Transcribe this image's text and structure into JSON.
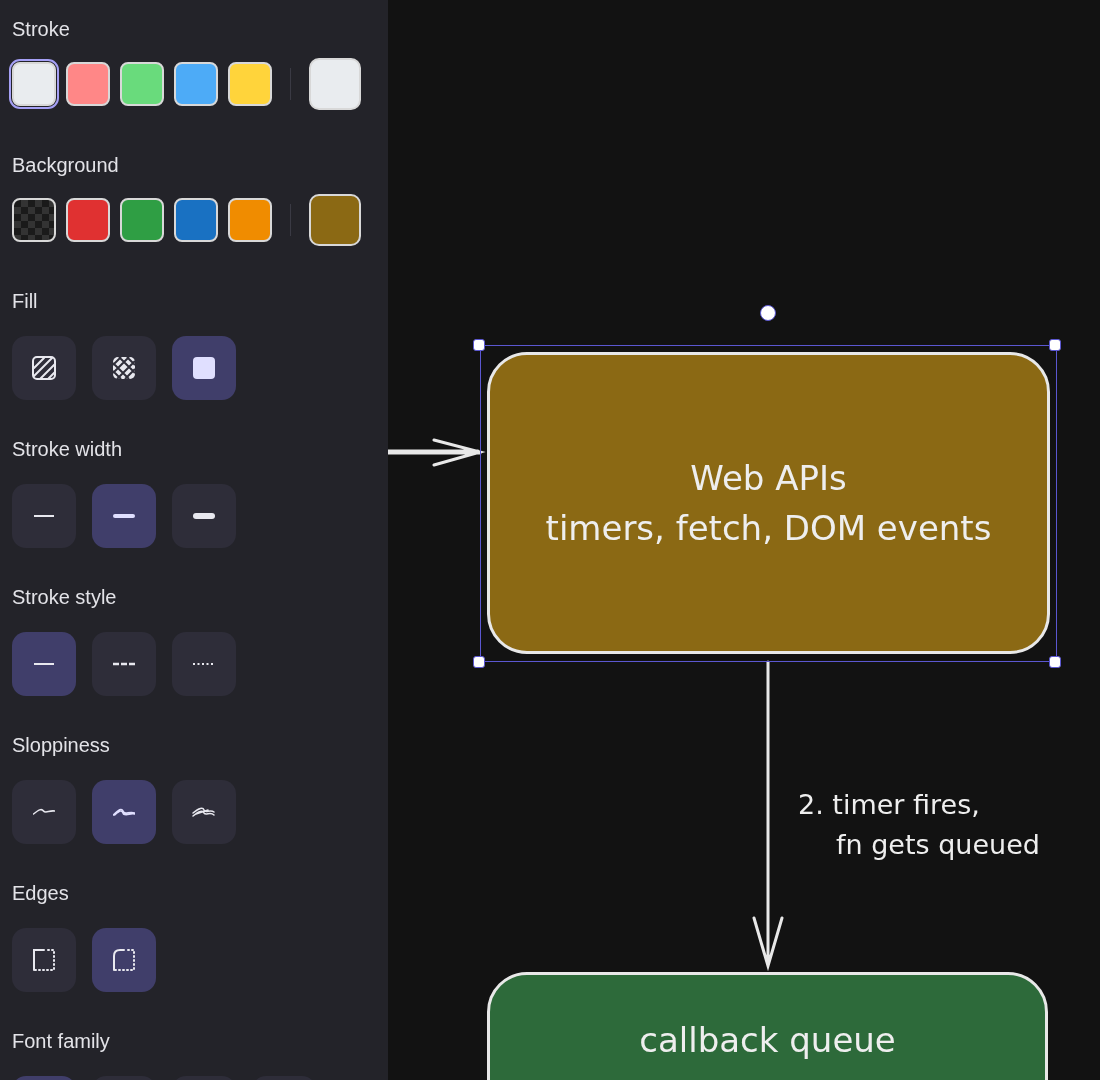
{
  "sidebar": {
    "sections": [
      {
        "kind": "swatches",
        "label": "Stroke",
        "swatches": [
          {
            "kind": "color",
            "color": "#e9ecef",
            "selected": true
          },
          {
            "kind": "color",
            "color": "#ff8787",
            "selected": false
          },
          {
            "kind": "color",
            "color": "#69db7c",
            "selected": false
          },
          {
            "kind": "color",
            "color": "#4dabf7",
            "selected": false
          },
          {
            "kind": "color",
            "color": "#ffd43b",
            "selected": false
          }
        ],
        "current": {
          "color": "#e9ecef"
        }
      },
      {
        "kind": "swatches",
        "label": "Background",
        "swatches": [
          {
            "kind": "transparent",
            "selected": false
          },
          {
            "kind": "color",
            "color": "#e03131",
            "selected": false
          },
          {
            "kind": "color",
            "color": "#2f9e44",
            "selected": false
          },
          {
            "kind": "color",
            "color": "#1971c2",
            "selected": false
          },
          {
            "kind": "color",
            "color": "#f08c00",
            "selected": false
          }
        ],
        "current": {
          "color": "#8b6914"
        }
      },
      {
        "kind": "options",
        "label": "Fill",
        "options": [
          {
            "kind": "hachure",
            "selected": false
          },
          {
            "kind": "cross-hatch",
            "selected": false
          },
          {
            "kind": "solid",
            "selected": true
          }
        ]
      },
      {
        "kind": "options",
        "label": "Stroke width",
        "options": [
          {
            "kind": "thin",
            "selected": false
          },
          {
            "kind": "bold",
            "selected": true
          },
          {
            "kind": "extra-bold",
            "selected": false
          }
        ]
      },
      {
        "kind": "options",
        "label": "Stroke style",
        "options": [
          {
            "kind": "solid-line",
            "selected": true
          },
          {
            "kind": "dashed",
            "selected": false
          },
          {
            "kind": "dotted",
            "selected": false
          }
        ]
      },
      {
        "kind": "options",
        "label": "Sloppiness",
        "options": [
          {
            "kind": "architect",
            "selected": false
          },
          {
            "kind": "artist",
            "selected": true
          },
          {
            "kind": "cartoonist",
            "selected": false
          }
        ]
      },
      {
        "kind": "options",
        "label": "Edges",
        "options": [
          {
            "kind": "sharp",
            "selected": false
          },
          {
            "kind": "round",
            "selected": true
          }
        ]
      },
      {
        "kind": "options",
        "label": "Font family",
        "options": [
          {
            "kind": "font",
            "selected": true
          },
          {
            "kind": "font",
            "selected": false
          },
          {
            "kind": "font",
            "selected": false
          },
          {
            "kind": "font",
            "selected": false
          }
        ]
      }
    ]
  },
  "canvas": {
    "nodes": [
      {
        "lines": [
          "Web APIs",
          "timers, fetch, DOM events"
        ],
        "color": "#8b6914",
        "selected": true
      },
      {
        "lines": [
          "callback queue"
        ],
        "color": "#2d6a3a",
        "selected": false
      }
    ],
    "edge_label": [
      "2. timer fires,",
      "fn gets queued"
    ]
  }
}
